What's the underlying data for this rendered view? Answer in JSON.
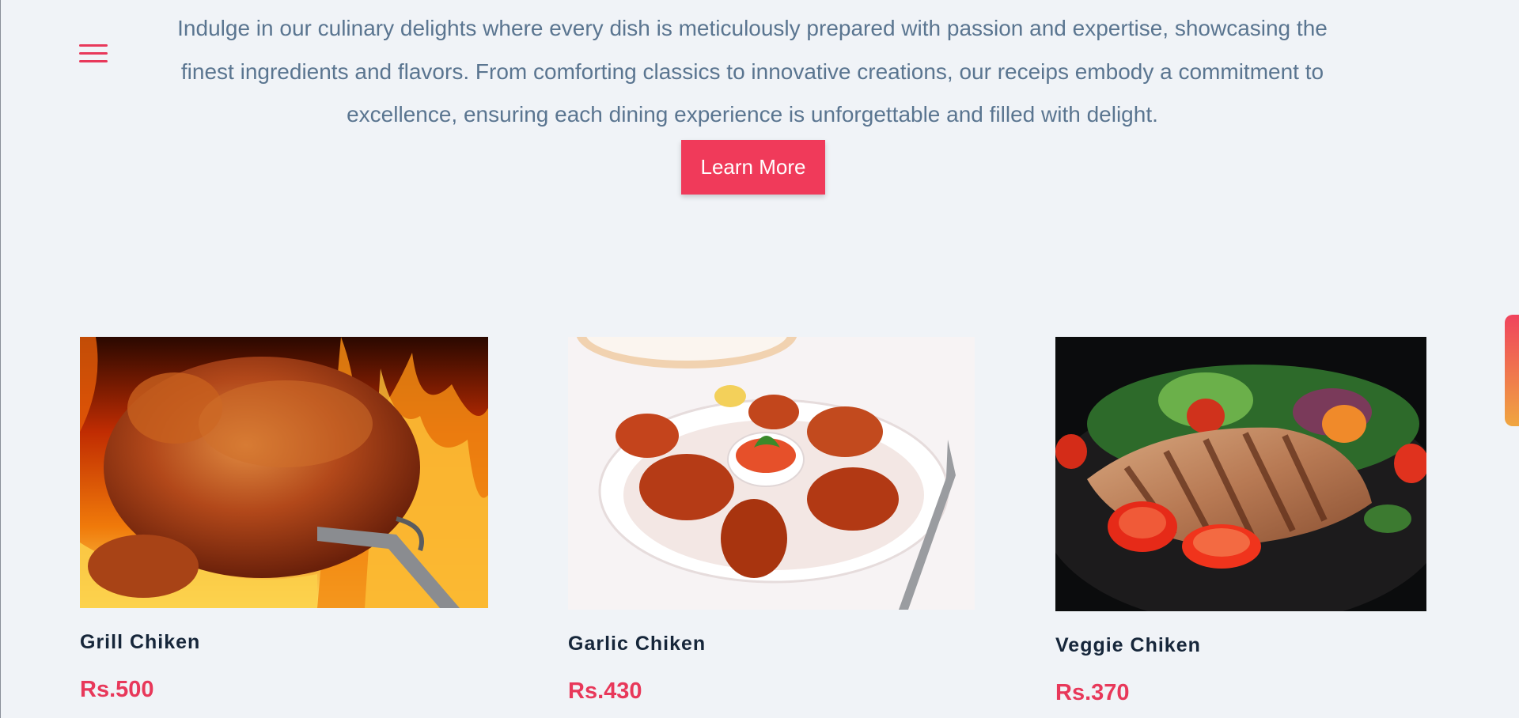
{
  "intro": {
    "line1": "Indulge in our culinary delights where every dish is meticulously prepared with passion and expertise, showcasing the",
    "line2": "finest ingredients and flavors. From comforting classics to innovative creations, our receips embody a commitment to",
    "line3": "excellence, ensuring each dining experience is unforgettable and filled with delight."
  },
  "cta": {
    "learn_more": "Learn More"
  },
  "colors": {
    "accent": "#e8385a",
    "button": "#f03a5a",
    "body_text": "#5a7590",
    "title_text": "#16263a",
    "background": "#f0f3f7"
  },
  "icons": {
    "menu": "hamburger-menu-icon"
  },
  "dishes": [
    {
      "name": "Grill Chiken",
      "price": "Rs.500",
      "image": "rotisserie chicken over flames"
    },
    {
      "name": "Garlic Chiken",
      "price": "Rs.430",
      "image": "fried chicken pieces on white plate with dip"
    },
    {
      "name": "Veggie Chiken",
      "price": "Rs.370",
      "image": "grilled chicken breast with salad on dark plate"
    }
  ]
}
